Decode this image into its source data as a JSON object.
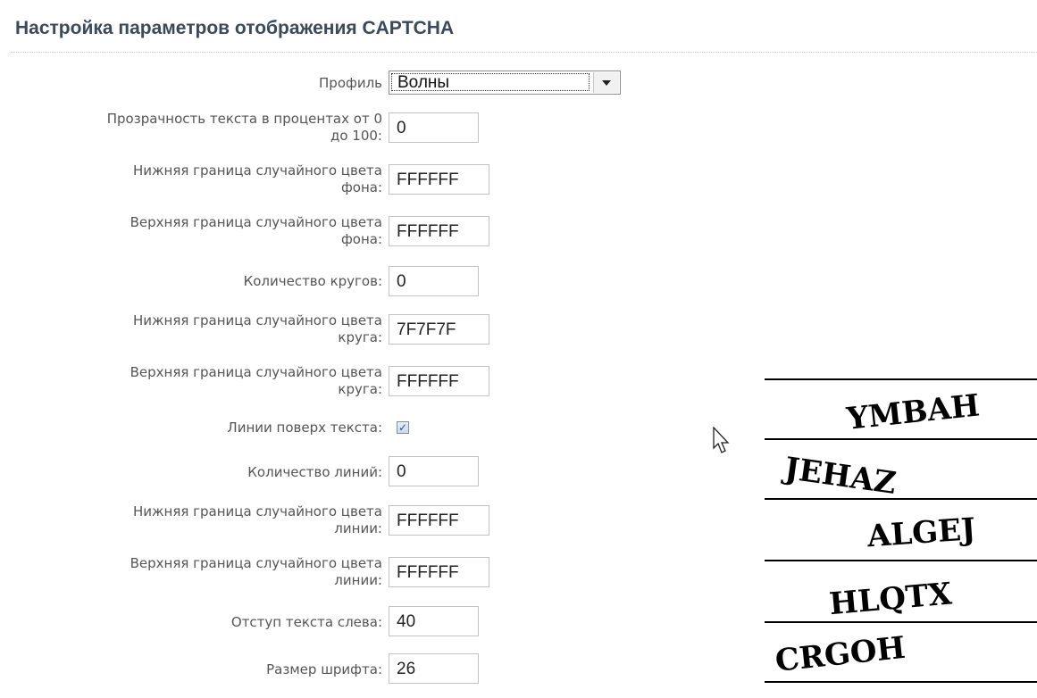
{
  "title": "Настройка параметров отображения CAPTCHA",
  "profile": {
    "label": "Профиль",
    "value": "Волны"
  },
  "fields": [
    {
      "label1": "Прозрачность текста в процентах от 0",
      "label2": "до 100:",
      "value": "0"
    },
    {
      "label1": "Нижняя граница случайного цвета",
      "label2": "фона:",
      "value": "FFFFFF"
    },
    {
      "label1": "Верхняя граница случайного цвета",
      "label2": "фона:",
      "value": "FFFFFF"
    },
    {
      "label1": "",
      "label2": "Количество кругов:",
      "value": "0"
    },
    {
      "label1": "Нижняя граница случайного цвета",
      "label2": "круга:",
      "value": "7F7F7F"
    },
    {
      "label1": "Верхняя граница случайного цвета",
      "label2": "круга:",
      "value": "FFFFFF"
    },
    {
      "label1": "",
      "label2": "Количество линий:",
      "value": "0"
    },
    {
      "label1": "Нижняя граница случайного цвета",
      "label2": "линии:",
      "value": "FFFFFF"
    },
    {
      "label1": "Верхняя граница случайного цвета",
      "label2": "линии:",
      "value": "FFFFFF"
    },
    {
      "label1": "",
      "label2": "Отступ текста слева:",
      "value": "40"
    },
    {
      "label1": "",
      "label2": "Размер шрифта:",
      "value": "26"
    }
  ],
  "lines_over_text": {
    "label": "Линии поверх текста:",
    "checked": true
  },
  "captchas": [
    "YMBAH",
    "JEHAZ",
    "ALGEJ",
    "HLQTX",
    "CRGOH"
  ]
}
